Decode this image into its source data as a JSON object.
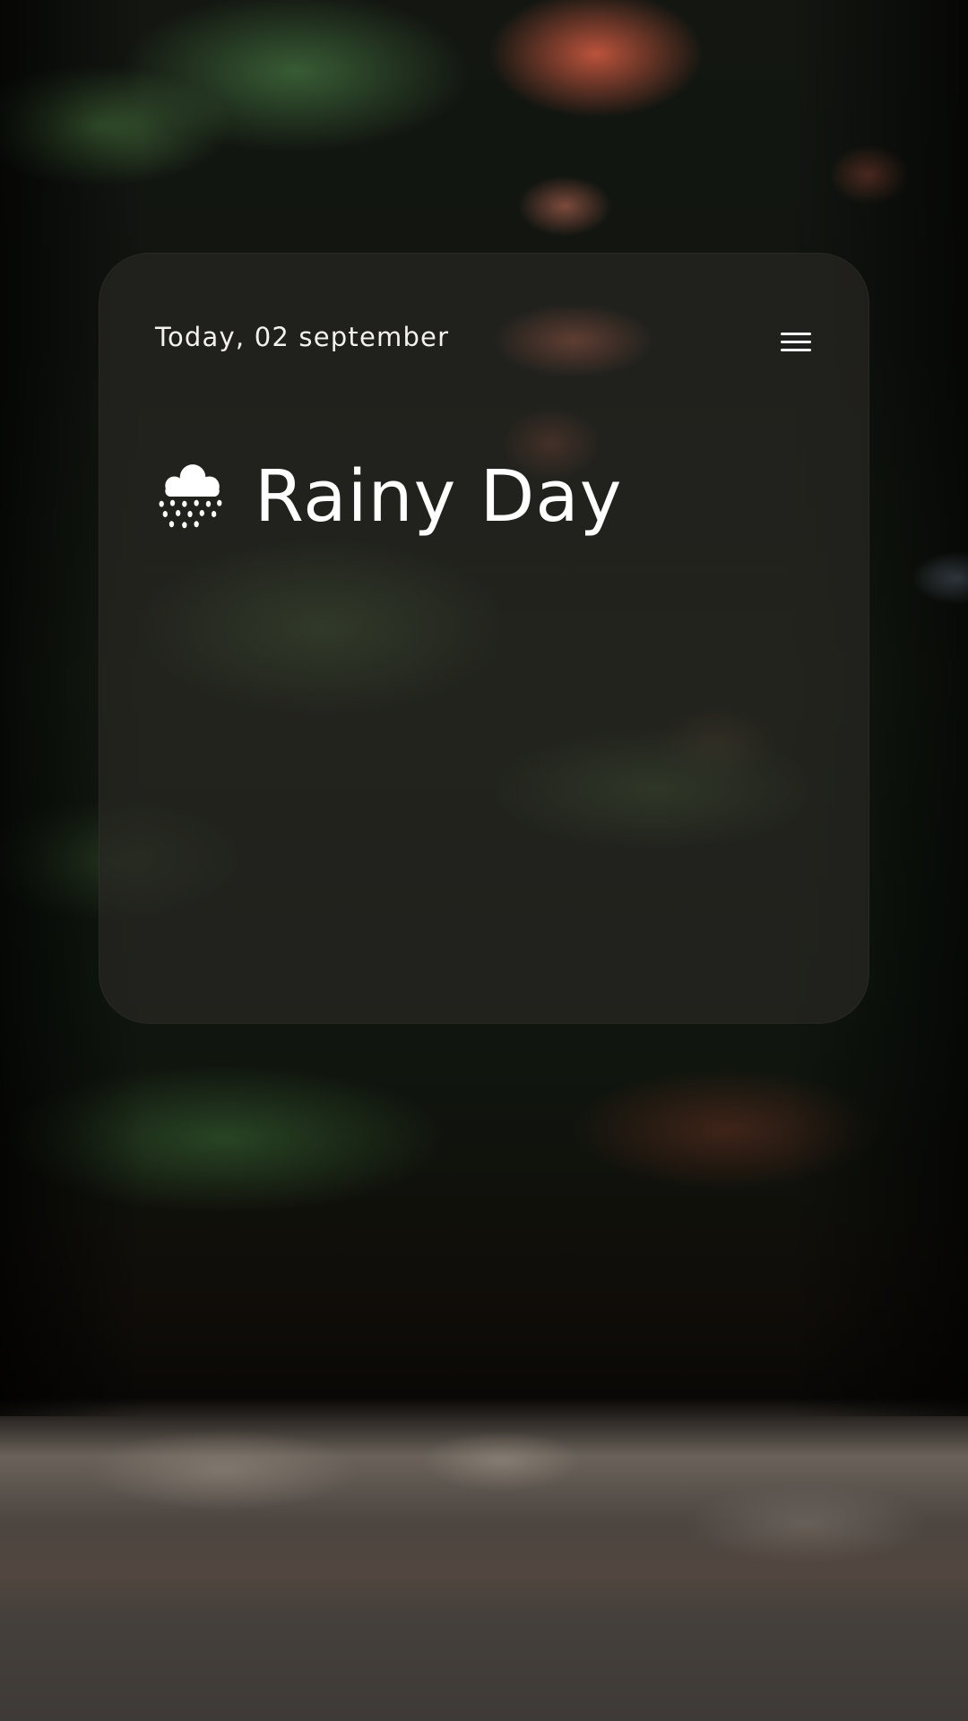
{
  "card": {
    "date_text": "Today, 02 september",
    "condition": "Rainy Day",
    "weather_icon": "cloud-rain-icon",
    "menu_icon": "hamburger-menu-icon"
  },
  "colors": {
    "text": "#ffffff",
    "card_tint": "#2a2824"
  }
}
